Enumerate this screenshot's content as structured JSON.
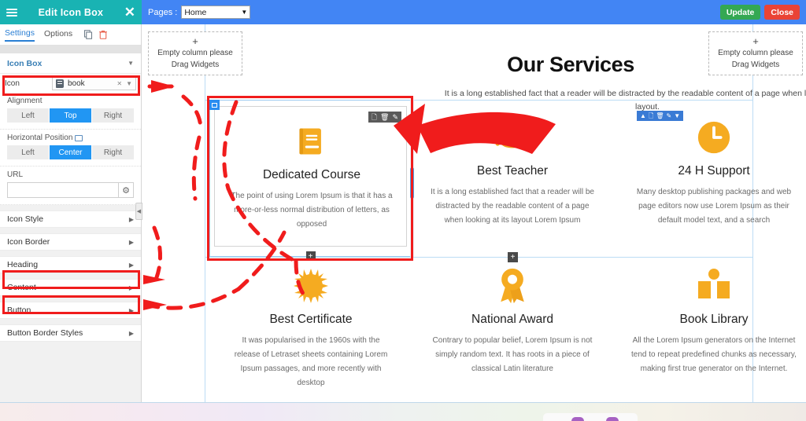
{
  "panel": {
    "title": "Edit Icon Box",
    "hamburger_icon": "hamburger-menu-icon",
    "close_icon": "close-icon",
    "tabs": [
      {
        "label": "Settings",
        "active": true
      },
      {
        "label": "Options",
        "active": false
      }
    ],
    "tab_icons": [
      "copy-icon",
      "trash-icon"
    ],
    "widget_name": "Icon Box",
    "icon_field": {
      "label": "Icon",
      "value": "book",
      "icon": "book-icon",
      "clear_icon": "clear-x-icon",
      "dropdown_icon": "chevron-down-icon"
    },
    "alignment": {
      "label": "Alignment",
      "options": [
        "Left",
        "Top",
        "Right"
      ],
      "selected": "Top"
    },
    "horizontal_position": {
      "label": "Horizontal Position",
      "device_icon": "desktop-monitor-icon",
      "options": [
        "Left",
        "Center",
        "Right"
      ],
      "selected": "Center"
    },
    "url": {
      "label": "URL",
      "value": "",
      "placeholder": "",
      "gear_icon": "gear-icon"
    },
    "accordions": [
      {
        "label": "Icon Style",
        "highlighted": false
      },
      {
        "label": "Icon Border",
        "highlighted": false
      },
      {
        "label": "Heading",
        "highlighted": true
      },
      {
        "label": "Content",
        "highlighted": true
      },
      {
        "label": "Button",
        "highlighted": false
      },
      {
        "label": "Button Border Styles",
        "highlighted": false
      }
    ],
    "collapse_handle_icon": "collapse-left-icon"
  },
  "topbar": {
    "pages_label": "Pages :",
    "page_selected": "Home",
    "page_dropdown_icon": "chevron-down-icon",
    "update_label": "Update",
    "close_label": "Close"
  },
  "canvas": {
    "empty_columns": [
      {
        "plus": "+",
        "line1": "Empty column please",
        "line2": "Drag Widgets"
      },
      {
        "plus": "+",
        "line1": "Empty column please",
        "line2": "Drag Widgets"
      }
    ],
    "hero": {
      "title": "Our Services",
      "subtitle": "It is a long established fact that a reader will be distracted by the readable content of a page when looking at its layout."
    },
    "section_toolbar_icons": [
      "caret-up-icon",
      "duplicate-icon",
      "trash-icon",
      "edit-pencil-icon",
      "caret-down-icon"
    ],
    "widget_toolbar_icons": [
      "duplicate-icon",
      "trash-icon",
      "edit-pencil-icon"
    ],
    "widget_badge_icon": "columns-icon",
    "add-widget-handle-icon": "plus-handle-icon",
    "cards": [
      {
        "icon": "book-icon",
        "title": "Dedicated Course",
        "text": "The point of using Lorem Ipsum is that it has a more-or-less normal distribution of letters, as opposed",
        "selected": true
      },
      {
        "icon": "graduation-cap-icon",
        "title": "Best Teacher",
        "text": "It is a long established fact that a reader will be distracted by the readable content of a page when looking at its layout Lorem Ipsum",
        "selected": false
      },
      {
        "icon": "clock-icon",
        "title": "24 H Support",
        "text": "Many desktop publishing packages and web page editors now use Lorem Ipsum as their default model text, and a search",
        "selected": false
      },
      {
        "icon": "sun-burst-icon",
        "title": "Best Certificate",
        "text": "It was popularised in the 1960s with the release of Letraset sheets containing Lorem Ipsum passages, and more recently with desktop",
        "selected": false
      },
      {
        "icon": "award-medal-icon",
        "title": "National Award",
        "text": "Contrary to popular belief, Lorem Ipsum is not simply random text. It has roots in a piece of classical Latin literature",
        "selected": false
      },
      {
        "icon": "open-book-icon",
        "title": "Book Library",
        "text": "All the Lorem Ipsum generators on the Internet tend to repeat predefined chunks as necessary, making first true generator on the Internet.",
        "selected": false
      }
    ]
  },
  "colors": {
    "panel_header": "#19b3b3",
    "topbar": "#4285f4",
    "accent_blue": "#2196f3",
    "update_green": "#34a853",
    "close_red": "#ea4335",
    "icon_yellow": "#f5ab21",
    "annotation_red": "#f01c1c"
  }
}
